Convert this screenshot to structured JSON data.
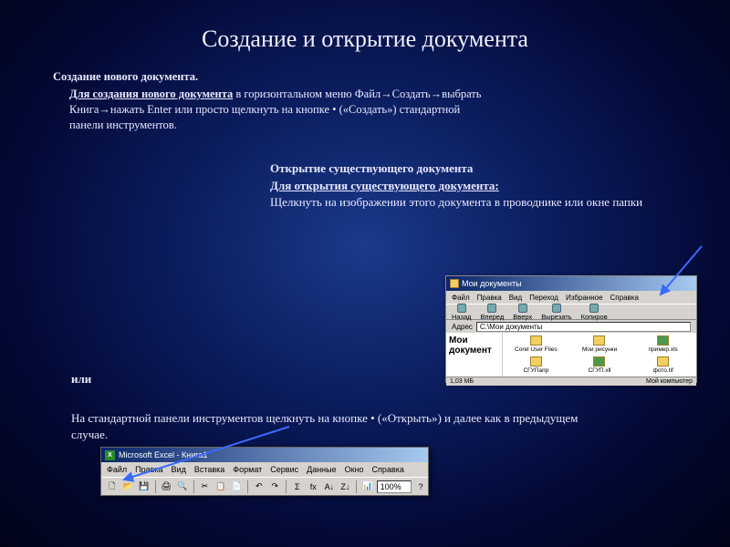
{
  "title": "Создание и открытие документа",
  "sec1": {
    "heading": "Создание нового документа.",
    "underline": "Для создания нового документа",
    "body": " в горизонтальном меню Файл→Создать→выбрать Книга→нажать Enter или просто щелкнуть на кнопке • («Создать») стандартной панели инструментов."
  },
  "sec2": {
    "heading": "Открытие существующего документа",
    "underline": "Для открытия существующего документа:",
    "body": "Щелкнуть на изображении этого документа в проводнике или окне папки"
  },
  "explorer": {
    "title": "Мои документы",
    "menu": [
      "Файл",
      "Правка",
      "Вид",
      "Переход",
      "Избранное",
      "Справка"
    ],
    "nav": [
      "Назад",
      "Вперед",
      "Вверх",
      "Вырезать",
      "Копиров"
    ],
    "addr_label": "Адрес",
    "addr_value": "С:\\Мои документы",
    "left_label": "Мои документ",
    "items": [
      "Corel User Files",
      "Мои рисунки",
      "пример.xls",
      "СГУПапр",
      "СГУП.xll",
      "фото.tif"
    ],
    "status_left": "1,03 МБ",
    "status_right": "Мой компьютер"
  },
  "ili": "или",
  "sec3": "На стандартной панели инструментов щелкнуть на кнопке • («Открыть») и далее как в предыдущем случае.",
  "excel": {
    "title": "Microsoft Excel - Книга1",
    "icon": "X",
    "menu": [
      "Файл",
      "Правка",
      "Вид",
      "Вставка",
      "Формат",
      "Сервис",
      "Данные",
      "Окно",
      "Справка"
    ],
    "zoom": "100%"
  }
}
